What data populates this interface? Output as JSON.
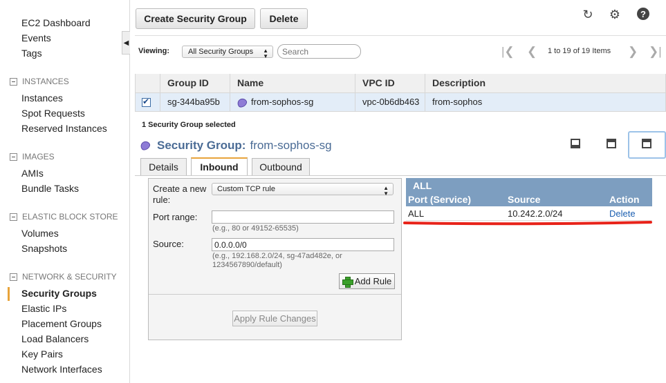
{
  "sidebar": {
    "top_links": [
      "EC2 Dashboard",
      "Events",
      "Tags"
    ],
    "sections": [
      {
        "title": "INSTANCES",
        "items": [
          "Instances",
          "Spot Requests",
          "Reserved Instances"
        ]
      },
      {
        "title": "IMAGES",
        "items": [
          "AMIs",
          "Bundle Tasks"
        ]
      },
      {
        "title": "ELASTIC BLOCK STORE",
        "items": [
          "Volumes",
          "Snapshots"
        ]
      },
      {
        "title": "NETWORK & SECURITY",
        "items": [
          "Security Groups",
          "Elastic IPs",
          "Placement Groups",
          "Load Balancers",
          "Key Pairs",
          "Network Interfaces"
        ]
      }
    ],
    "active_item": "Security Groups",
    "toggle_glyph": "◀"
  },
  "toolbar": {
    "create_label": "Create Security Group",
    "delete_label": "Delete",
    "refresh_glyph": "↻",
    "settings_glyph": "⚙",
    "help_glyph": "?"
  },
  "viewing": {
    "label": "Viewing:",
    "filter_value": "All Security Groups",
    "search_placeholder": "Search",
    "pager_text": "1 to 19 of 19 Items",
    "first_glyph": "|❮",
    "prev_glyph": "❮",
    "next_glyph": "❯",
    "last_glyph": "❯|"
  },
  "table": {
    "headers": [
      "Group ID",
      "Name",
      "VPC ID",
      "Description"
    ],
    "rows": [
      {
        "group_id": "sg-344ba95b",
        "name": "from-sophos-sg",
        "vpc_id": "vpc-0b6db463",
        "description": "from-sophos",
        "selected": true
      }
    ]
  },
  "detail": {
    "selected_count": "1 Security Group selected",
    "title_prefix": "Security Group:",
    "title_name": "from-sophos-sg",
    "tabs": [
      "Details",
      "Inbound",
      "Outbound"
    ],
    "active_tab": "Inbound"
  },
  "inbound_form": {
    "create_label": "Create a new rule:",
    "rule_type": "Custom TCP rule",
    "port_label": "Port range:",
    "port_value": "",
    "port_hint": "(e.g., 80 or 49152-65535)",
    "source_label": "Source:",
    "source_value": "0.0.0.0/0",
    "source_hint": "(e.g., 192.168.2.0/24, sg-47ad482e, or 1234567890/default)",
    "add_rule_label": "Add Rule",
    "apply_label": "Apply Rule Changes"
  },
  "rules": {
    "group_title": "ALL",
    "headers": [
      "Port (Service)",
      "Source",
      "Action"
    ],
    "rows": [
      {
        "port": "ALL",
        "source": "10.242.2.0/24",
        "action": "Delete"
      }
    ],
    "highlight_color": "#e8231a"
  }
}
